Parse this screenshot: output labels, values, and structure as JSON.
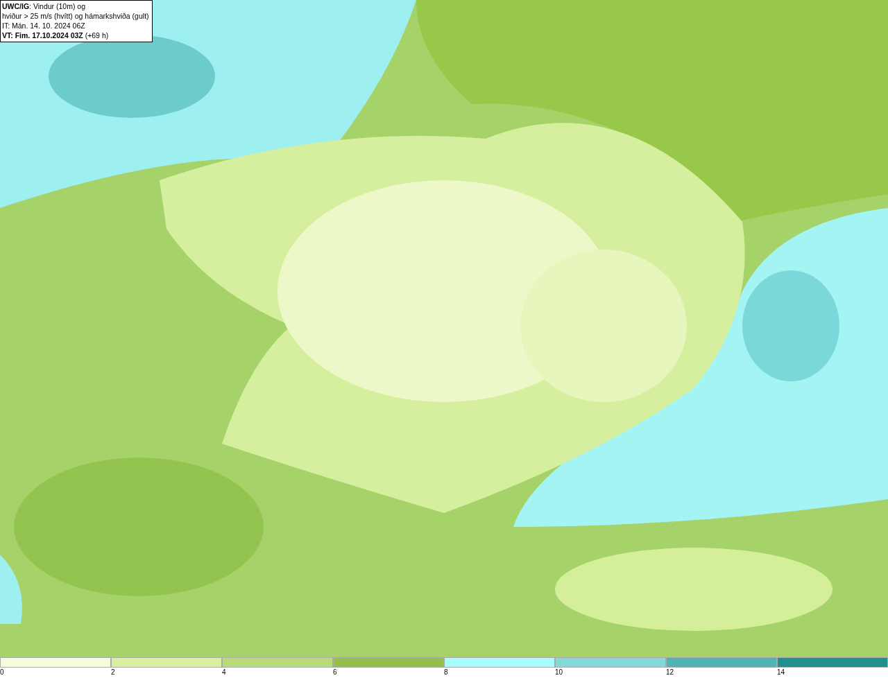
{
  "legend_box": {
    "lines": [
      "**UWC/IG**: Vindur (10m) og",
      "hviður > 25 m/s (hvítt) og hámarkshviða (gult)",
      "IT: Mán. 14. 10. 2024 06Z",
      "**VT: Fim. 17.10.2024 03Z** (+69 h)"
    ]
  },
  "colorbar": {
    "segments": [
      {
        "label": "0",
        "color": "#f4fcdc"
      },
      {
        "label": "2",
        "color": "#d8f0a0"
      },
      {
        "label": "4",
        "color": "#b8dc78"
      },
      {
        "label": "6",
        "color": "#94c04a"
      },
      {
        "label": "8",
        "color": "#a8fcfc"
      },
      {
        "label": "10",
        "color": "#84d8d8"
      },
      {
        "label": "12",
        "color": "#50b4b4"
      },
      {
        "label": "14",
        "color": "#209090"
      }
    ]
  }
}
